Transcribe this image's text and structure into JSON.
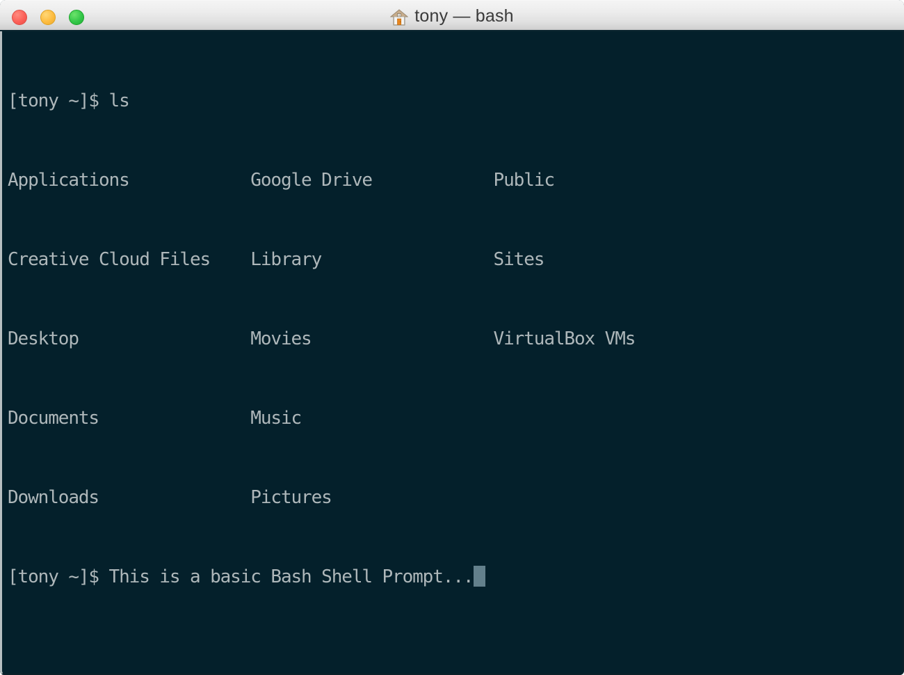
{
  "window": {
    "title": "tony — bash",
    "home_icon": "home-icon",
    "controls": {
      "close_label": "close",
      "minimize_label": "minimize",
      "maximize_label": "maximize"
    }
  },
  "theme": {
    "background": "#04202b",
    "foreground": "#aeb7ba",
    "cursor": "#63808c",
    "titlebar_text": "#3a3a3a",
    "close_color": "#fc6058",
    "minimize_color": "#fdbc40",
    "maximize_color": "#34c749"
  },
  "terminal": {
    "prompt": "[tony ~]$ ",
    "lines": [
      {
        "type": "command",
        "text": "[tony ~]$ ls"
      },
      {
        "type": "output",
        "text": "Applications            Google Drive            Public"
      },
      {
        "type": "output",
        "text": "Creative Cloud Files    Library                 Sites"
      },
      {
        "type": "output",
        "text": "Desktop                 Movies                  VirtualBox VMs"
      },
      {
        "type": "output",
        "text": "Documents               Music"
      },
      {
        "type": "output",
        "text": "Downloads               Pictures"
      },
      {
        "type": "command",
        "text": "[tony ~]$ This is a basic Bash Shell Prompt..."
      }
    ],
    "listing_columns": [
      [
        "Applications",
        "Creative Cloud Files",
        "Desktop",
        "Documents",
        "Downloads"
      ],
      [
        "Google Drive",
        "Library",
        "Movies",
        "Music",
        "Pictures"
      ],
      [
        "Public",
        "Sites",
        "VirtualBox VMs"
      ]
    ],
    "last_command_text": "This is a basic Bash Shell Prompt...",
    "cursor_visible": true
  }
}
